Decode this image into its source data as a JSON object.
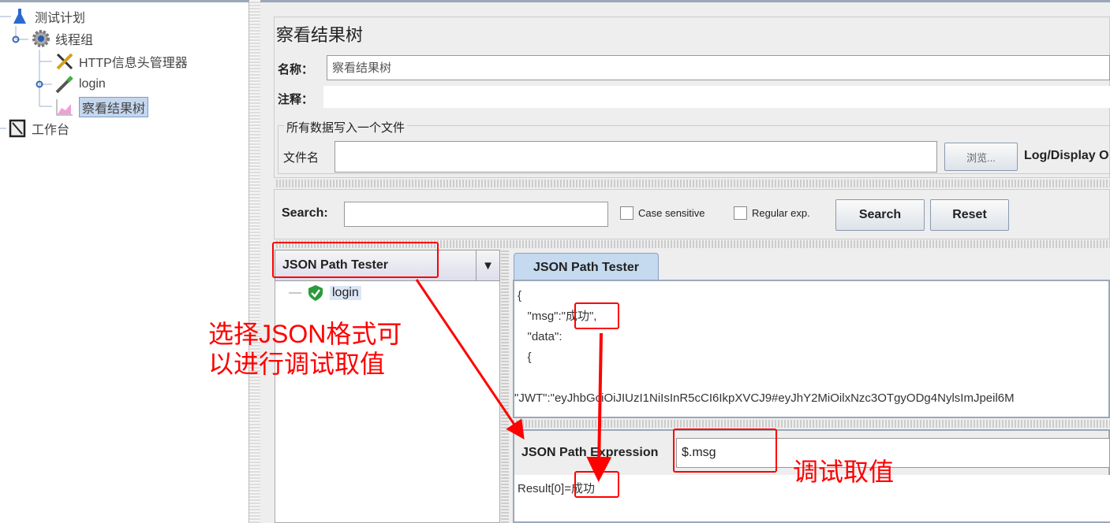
{
  "tree": {
    "items": [
      {
        "label": "测试计划",
        "icon": "flask-icon"
      },
      {
        "label": "线程组",
        "icon": "gear-icon"
      },
      {
        "label": "HTTP信息头管理器",
        "icon": "tools-icon"
      },
      {
        "label": "login",
        "icon": "pipette-icon"
      },
      {
        "label": "察看结果树",
        "icon": "chart-icon"
      },
      {
        "label": "工作台",
        "icon": "workbench-icon"
      }
    ]
  },
  "panel": {
    "title": "察看结果树",
    "name_label": "名称：",
    "name_value": "察看结果树",
    "comment_label": "注释：",
    "comment_value": "",
    "file_group": "所有数据写入一个文件",
    "file_label": "文件名",
    "file_value": "",
    "browse": "浏览...",
    "log_display": "Log/Display O"
  },
  "search": {
    "label": "Search:",
    "value": "",
    "case_sensitive": "Case sensitive",
    "regex": "Regular exp.",
    "search_btn": "Search",
    "reset_btn": "Reset"
  },
  "renderer": {
    "selected": "JSON Path Tester",
    "results": [
      {
        "label": "login",
        "status": "success"
      }
    ]
  },
  "tab": {
    "label": "JSON Path Tester"
  },
  "response": {
    "lines": [
      "{",
      "   \"msg\":\"成功\",",
      "   \"data\":",
      "   {",
      "",
      "\"JWT\":\"eyJhbGciOiJIUzI1NiIsInR5cCI6IkpXVCJ9#eyJhY2MiOilxNzc3OTgyODg4NylsImJpeil6M"
    ]
  },
  "jsonpath": {
    "label": "JSON Path Expression",
    "value": "$.msg",
    "result": "Result[0]=成功"
  },
  "annotations": {
    "left": "选择JSON格式可\n以进行调试取值",
    "right": "调试取值",
    "color": "#ff0000"
  }
}
